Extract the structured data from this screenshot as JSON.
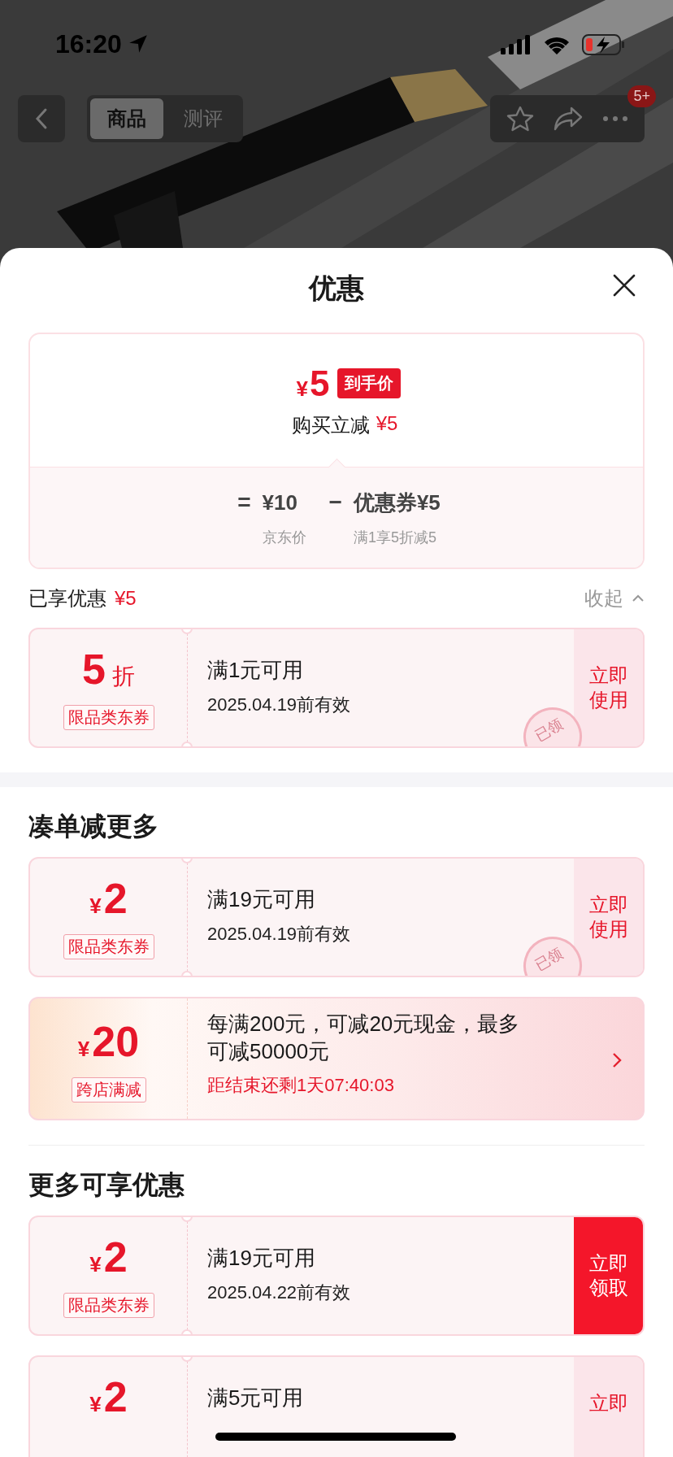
{
  "status_bar": {
    "time": "16:20"
  },
  "nav": {
    "tabs": [
      {
        "label": "商品",
        "selected": true
      },
      {
        "label": "测评",
        "selected": false
      }
    ],
    "badge": "5+"
  },
  "sheet": {
    "title": "优惠"
  },
  "price_card": {
    "currency": "¥",
    "price": "5",
    "badge": "到手价",
    "saving_label": "购买立减",
    "saving_amount": "¥5",
    "breakdown": [
      {
        "sign": "=",
        "value": "¥10",
        "label": "京东价"
      },
      {
        "sign": "−",
        "value": "优惠券¥5",
        "label": "满1享5折减5"
      }
    ]
  },
  "applied": {
    "label": "已享优惠",
    "amount": "¥5",
    "toggle": "收起",
    "expanded": true
  },
  "applied_coupons": [
    {
      "kind": "coupon",
      "amount": "5",
      "unit": "折",
      "tag": "限品类东券",
      "title": "满1元可用",
      "validity": "2025.04.19前有效",
      "stamp": "已领",
      "claimed": true,
      "action": "立即使用"
    }
  ],
  "sections": [
    {
      "heading": "凑单减更多",
      "coupons": [
        {
          "kind": "coupon",
          "currency": "¥",
          "amount": "2",
          "tag": "限品类东券",
          "title": "满19元可用",
          "validity": "2025.04.19前有效",
          "stamp": "已领",
          "claimed": true,
          "action": "立即使用"
        },
        {
          "kind": "promo",
          "currency": "¥",
          "amount": "20",
          "tag": "跨店满减",
          "title": "每满200元，可减20元现金，最多可减50000元",
          "countdown": "距结束还剩1天07:40:03"
        }
      ]
    },
    {
      "heading": "更多可享优惠",
      "coupons": [
        {
          "kind": "coupon",
          "currency": "¥",
          "amount": "2",
          "tag": "限品类东券",
          "title": "满19元可用",
          "validity": "2025.04.22前有效",
          "claimed": false,
          "action": "立即领取"
        },
        {
          "kind": "coupon",
          "currency": "¥",
          "amount": "2",
          "title": "满5元可用",
          "claimed": true,
          "action": "立即"
        }
      ]
    }
  ]
}
